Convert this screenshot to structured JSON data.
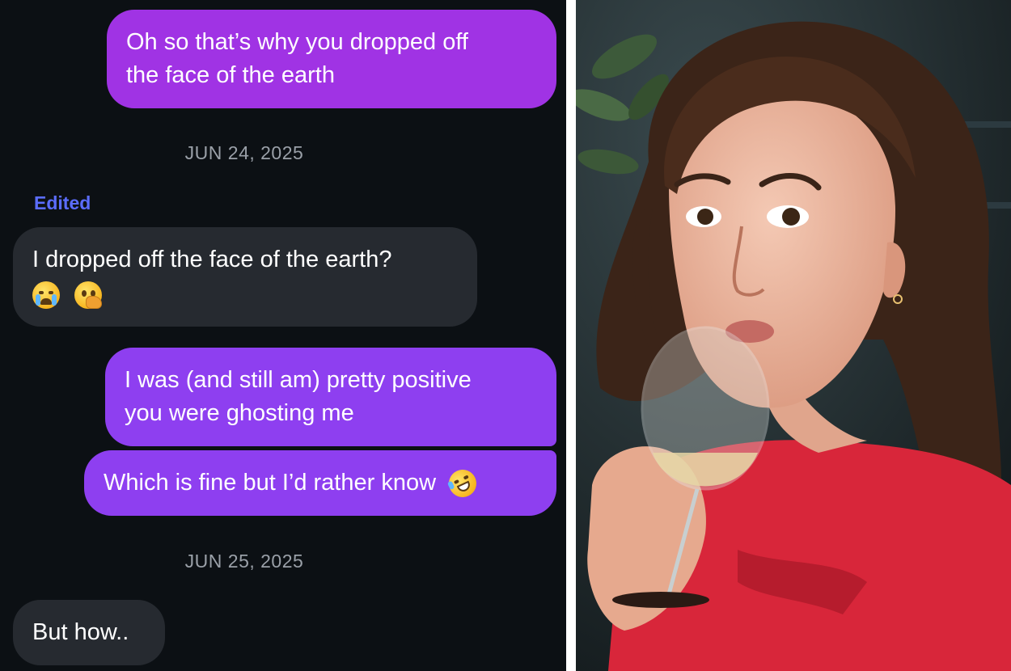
{
  "messages": [
    {
      "type": "outgoing",
      "lines": [
        "Oh so that’s why you dropped off",
        "the face of the earth"
      ]
    },
    {
      "type": "date",
      "text": "JUN 24, 2025"
    },
    {
      "type": "edited_label",
      "text": "Edited"
    },
    {
      "type": "incoming",
      "lines": [
        "I dropped off the face of the earth?"
      ],
      "emojis": [
        "loudly-crying-face-emoji",
        "face-with-hand-over-mouth-emoji"
      ]
    },
    {
      "type": "outgoing",
      "lines": [
        "I was (and still am) pretty positive",
        "you were ghosting me"
      ]
    },
    {
      "type": "outgoing",
      "lines": [
        "Which is fine but I’d rather know"
      ],
      "emojis": [
        "rolling-on-the-floor-laughing-emoji"
      ]
    },
    {
      "type": "date",
      "text": "JUN 25, 2025"
    },
    {
      "type": "incoming",
      "lines": [
        "But how.."
      ]
    }
  ],
  "colors": {
    "chat_background": "#0c1014",
    "outgoing_bubble": "#8e3ff0",
    "outgoing_bubble_top": "#a033e4",
    "incoming_bubble": "#262a30",
    "edited_label": "#5b6dff",
    "datestamp": "#9aa0a8"
  },
  "photo": {
    "description_icon": "woman-drinking-wine-photo"
  }
}
